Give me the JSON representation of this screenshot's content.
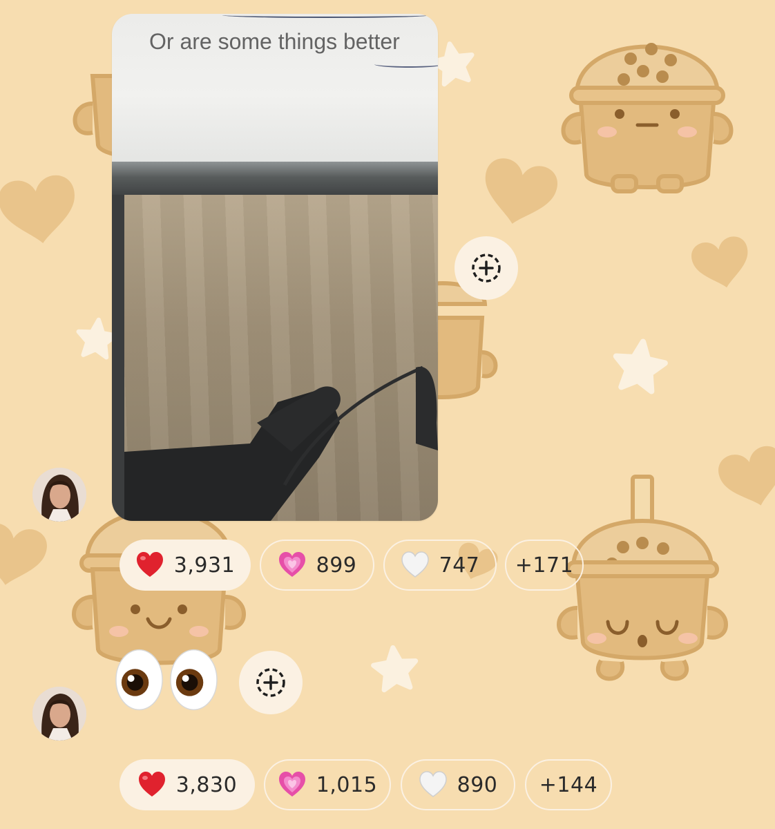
{
  "conversation": {
    "wallpaper_theme": "bubble-tea",
    "colors": {
      "background": "#f7ddb0",
      "chip": "#fbf1e3",
      "boba": "#e2ba7e"
    },
    "message_1": {
      "type": "photo",
      "photo_text": "Or are some things better",
      "add_reaction_icon": "add-reaction-icon",
      "reactions": [
        {
          "emoji": "❤️",
          "icon": "red-heart-icon",
          "count": "3,931",
          "selected": true
        },
        {
          "emoji": "💗",
          "icon": "growing-heart-icon",
          "count": "899",
          "selected": false
        },
        {
          "emoji": "🤍",
          "icon": "white-heart-icon",
          "count": "747",
          "selected": false
        },
        {
          "more": "+171"
        }
      ]
    },
    "message_2": {
      "type": "emoji",
      "emoji": "👀",
      "icon": "eyes-icon",
      "add_reaction_icon": "add-reaction-icon",
      "reactions": [
        {
          "emoji": "❤️",
          "icon": "red-heart-icon",
          "count": "3,830",
          "selected": true
        },
        {
          "emoji": "💗",
          "icon": "growing-heart-icon",
          "count": "1,015",
          "selected": false
        },
        {
          "emoji": "🤍",
          "icon": "white-heart-icon",
          "count": "890",
          "selected": false
        },
        {
          "more": "+144"
        }
      ]
    }
  }
}
